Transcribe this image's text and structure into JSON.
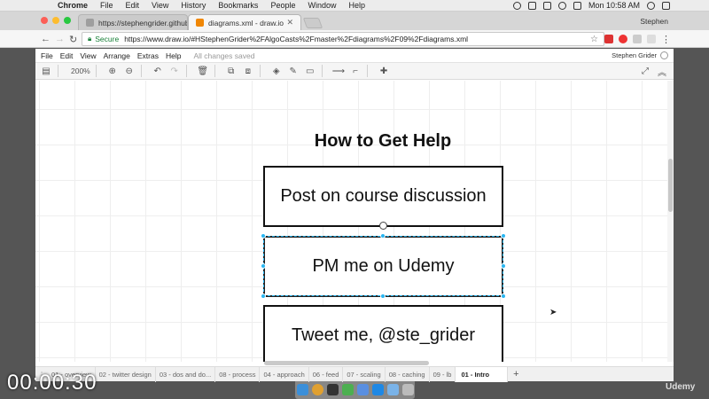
{
  "mac_menubar": {
    "app_name": "Chrome",
    "items": [
      "File",
      "Edit",
      "View",
      "History",
      "Bookmarks",
      "People",
      "Window",
      "Help"
    ],
    "clock": "Mon 10:58 AM"
  },
  "browser": {
    "tabs": [
      {
        "title": "https://stephengrider.github.io",
        "active": false,
        "favicon_color": "#9e9e9e"
      },
      {
        "title": "diagrams.xml - draw.io",
        "active": true,
        "favicon_color": "#f08705"
      }
    ],
    "profile_name": "Stephen",
    "secure_label": "Secure",
    "url": "https://www.draw.io/#HStephenGrider%2FAlgoCasts%2Fmaster%2Fdiagrams%2F09%2Fdiagrams.xml"
  },
  "app": {
    "menu": [
      "File",
      "Edit",
      "View",
      "Arrange",
      "Extras",
      "Help"
    ],
    "save_status": "All changes saved",
    "user": "Stephen Grider",
    "zoom": "200%"
  },
  "diagram": {
    "title": "How to Get Help",
    "boxes": [
      {
        "label": "Post on course discussion",
        "selected": false
      },
      {
        "label": "PM me on Udemy",
        "selected": true
      },
      {
        "label": "Tweet me, @ste_grider",
        "selected": false
      }
    ],
    "selection_color": "#29b6f2"
  },
  "pages": {
    "tabs": [
      "01 - overview",
      "02 - twitter design",
      "03 - dos and do...",
      "08 - process",
      "04 - approach",
      "06 - feed",
      "07 - scaling",
      "08 - caching",
      "09 - lb",
      "01 - Intro"
    ],
    "active": "01 - Intro"
  },
  "overlay": {
    "timer": "00:00:30",
    "brand": "Udemy"
  }
}
